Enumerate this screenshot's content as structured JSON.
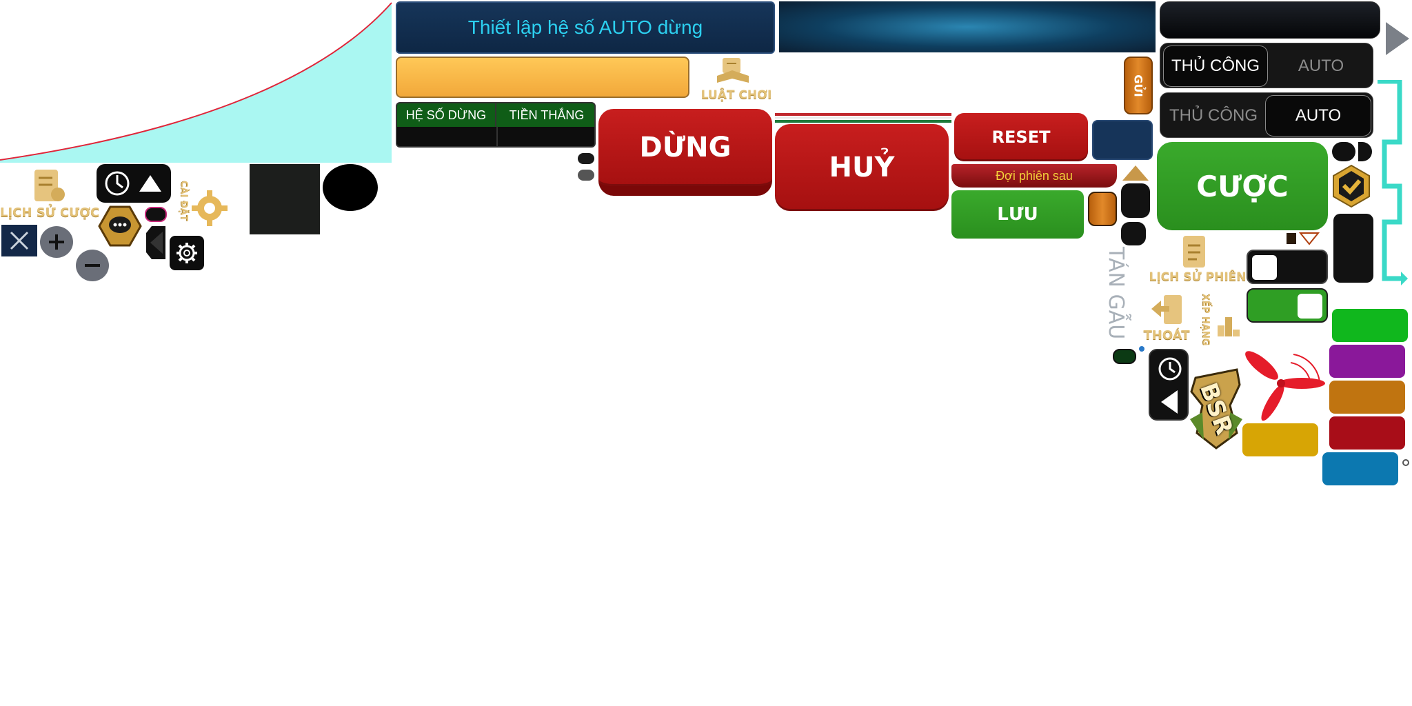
{
  "header": {
    "auto_stop_title": "Thiết lập hệ số AUTO dừng"
  },
  "table": {
    "col1": "HỆ SỐ DỪNG",
    "col2": "TIỀN THẮNG"
  },
  "buttons": {
    "stop": "DỪNG",
    "cancel": "HUỶ",
    "reset": "RESET",
    "save": "LƯU",
    "bet": "CƯỢC",
    "send": "GỬI",
    "next_round": "Đợi phiên sau"
  },
  "toggles": {
    "manual": "THỦ CÔNG",
    "auto": "AUTO"
  },
  "labels": {
    "rules": "LUẬT CHƠI",
    "bet_history": "LỊCH SỬ CƯỢC",
    "settings": "CÀI ĐẶT",
    "round_history": "LỊCH SỬ PHIÊN",
    "exit": "THOÁT",
    "ranking": "XẾP HẠNG",
    "chat": "TÁN GẪU",
    "logo": "BSR"
  },
  "colors": {
    "curve_fill": "#aaf7f2",
    "curve_line": "#e0263a",
    "red": "#b81a1a",
    "green": "#2f9e24",
    "gold": "#e3c27a",
    "teal": "#3ad9c7",
    "swatch_green": "#10b71d",
    "swatch_purple": "#8a189a",
    "swatch_orange": "#c07410",
    "swatch_red": "#a80d18",
    "swatch_blue": "#0c78b0",
    "swatch_yellow": "#d7a505"
  },
  "icons": [
    "document-icon",
    "clock-icon",
    "chat-icon",
    "gear-icon",
    "close-icon",
    "plus-icon",
    "minus-icon",
    "check-icon",
    "exit-icon",
    "ranking-icon",
    "book-icon",
    "propeller-icon",
    "triangle-play-icon",
    "back-arrow-icon",
    "caret-up-icon"
  ]
}
